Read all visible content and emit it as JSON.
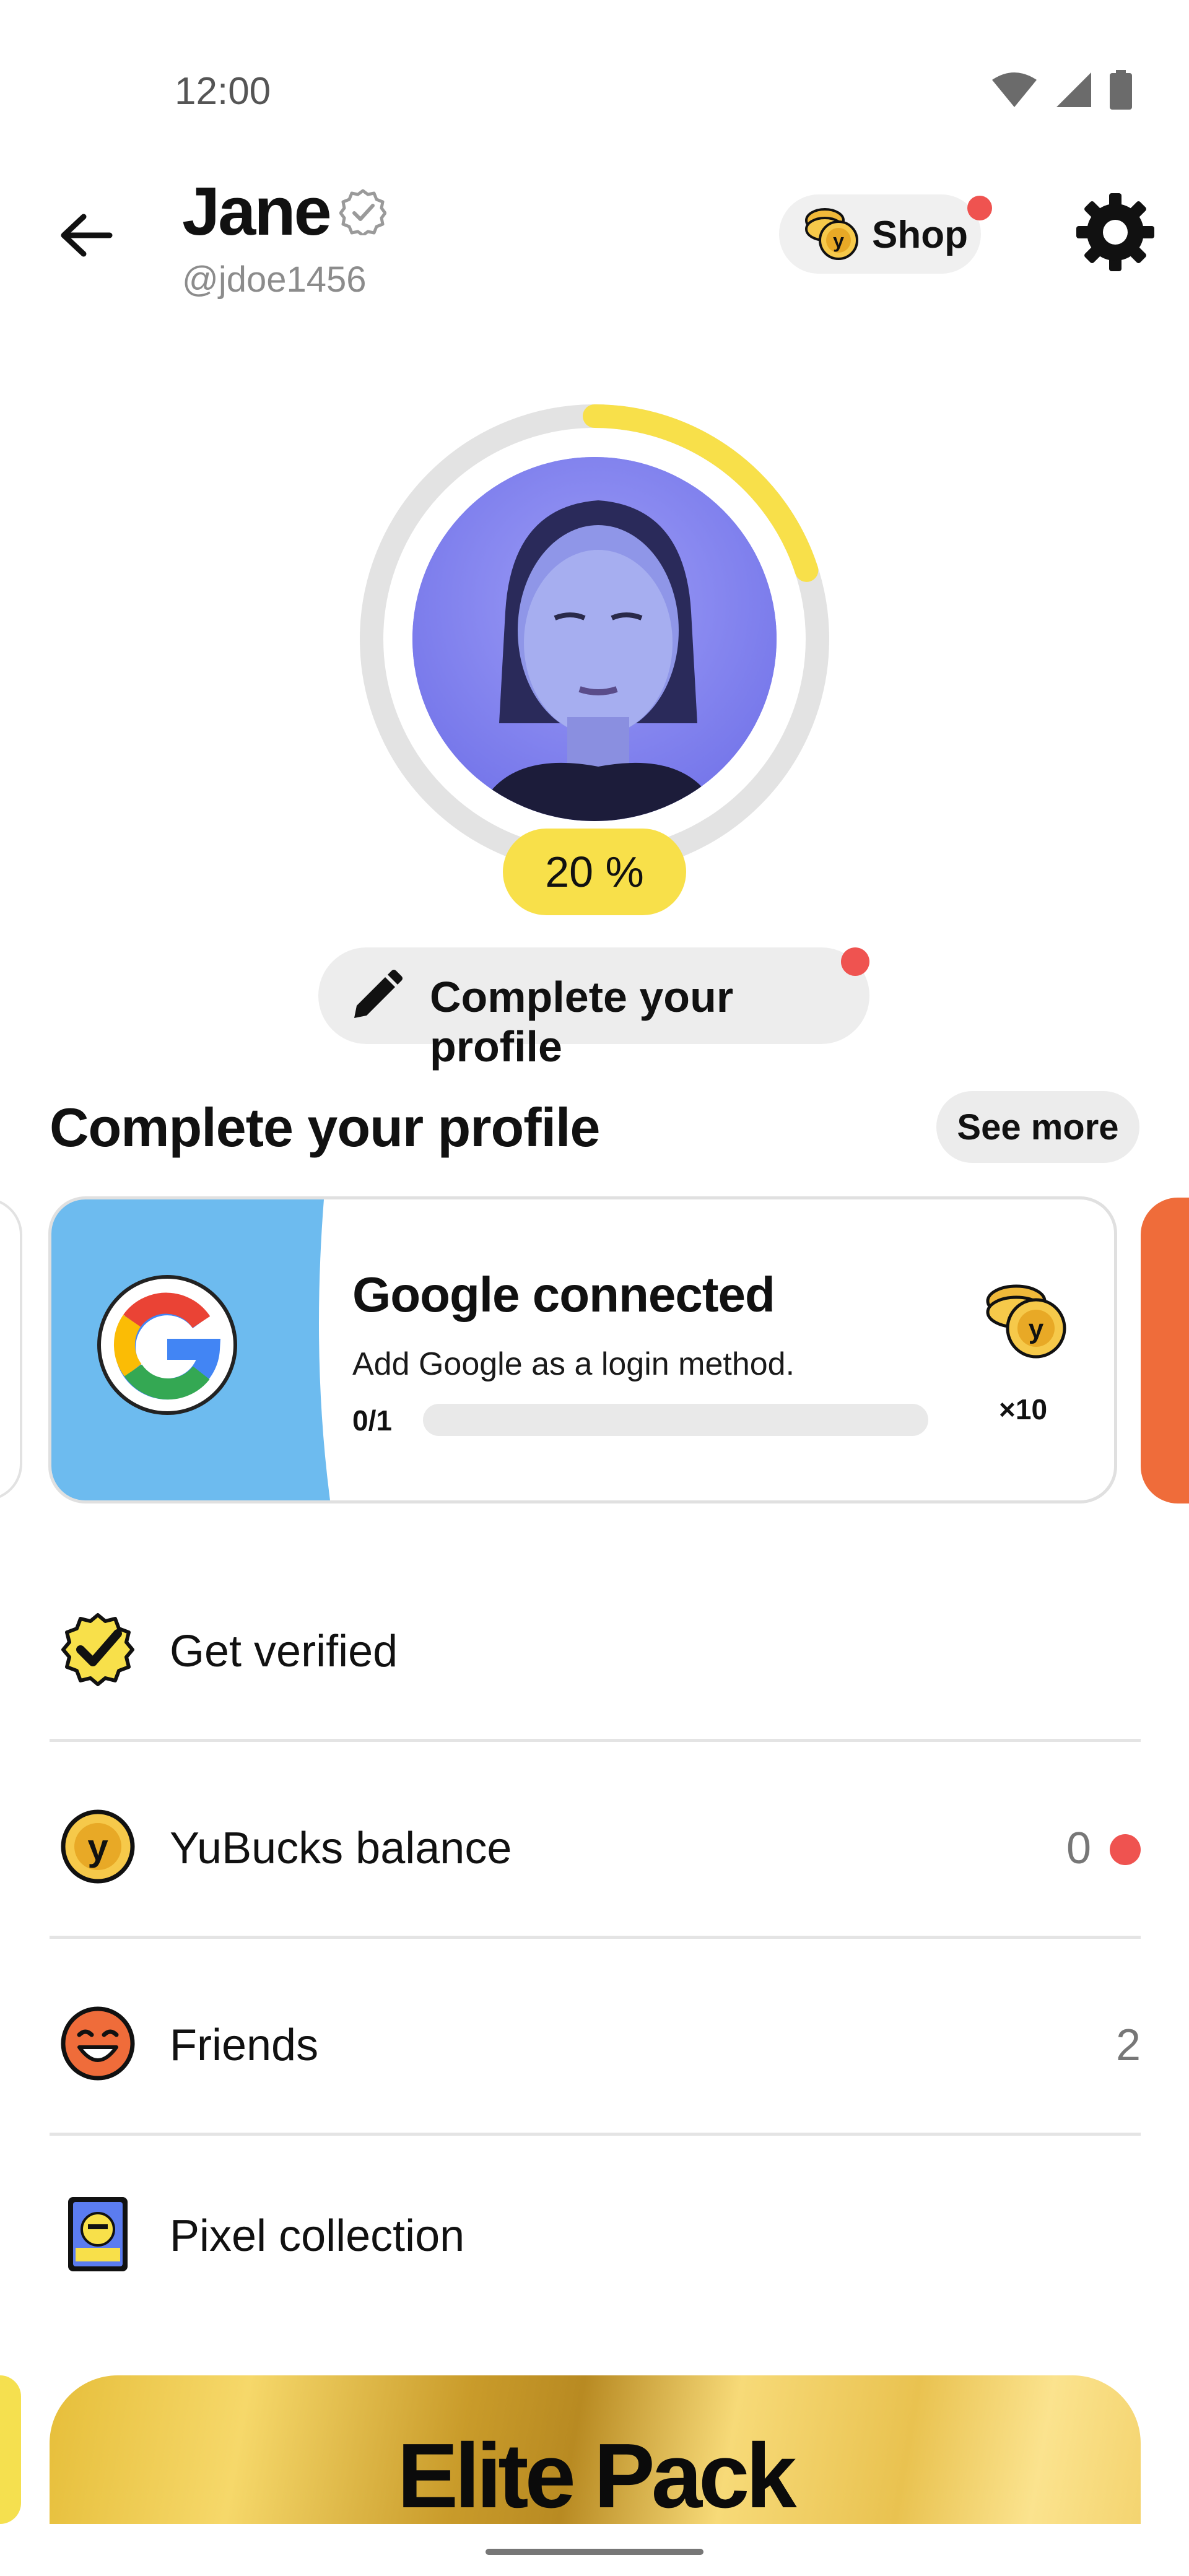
{
  "status_bar": {
    "time": "12:00",
    "icons": [
      "wifi-icon",
      "cellular-signal-icon",
      "battery-icon"
    ]
  },
  "header": {
    "name": "Jane",
    "handle": "@jdoe1456",
    "shop_label": "Shop",
    "verified_icon": "check-badge-icon"
  },
  "profile": {
    "completion_label": "20 %",
    "completion_fraction": 0.2,
    "complete_button_label": "Complete your profile",
    "ring_color": "#f8e04a"
  },
  "section": {
    "title": "Complete your profile",
    "see_more_label": "See more"
  },
  "task_card": {
    "title": "Google connected",
    "description": "Add Google as a login method.",
    "progress_text": "0/1",
    "progress_fraction": 0,
    "reward": "×10",
    "accent_color": "#6dbbef"
  },
  "list": [
    {
      "label": "Get verified",
      "value": "",
      "icon": "verified-badge-icon"
    },
    {
      "label": "YuBucks balance",
      "value": "0",
      "icon": "yubuck-coin-icon"
    },
    {
      "label": "Friends",
      "value": "2",
      "icon": "smiley-face-icon"
    },
    {
      "label": "Pixel collection",
      "value": "",
      "icon": "pixel-card-icon"
    }
  ],
  "elite_pack": {
    "label": "Elite Pack"
  },
  "colors": {
    "accent_yellow": "#f8e04a",
    "notification_red": "#ef5350",
    "next_card_orange": "#ef6c3a"
  }
}
